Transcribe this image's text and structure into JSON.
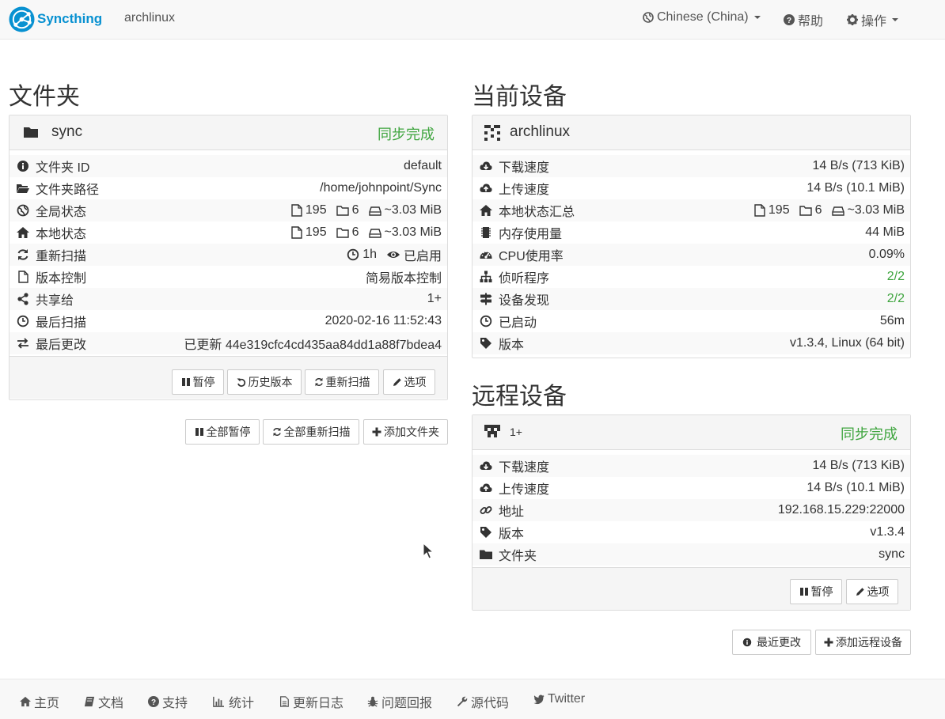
{
  "navbar": {
    "brand": "Syncthing",
    "hostname": "archlinux",
    "language": "Chinese (China)",
    "help": "帮助",
    "actions": "操作"
  },
  "folders": {
    "heading": "文件夹",
    "panel": {
      "name": "sync",
      "status": "同步完成",
      "rows": [
        {
          "label": "文件夹 ID",
          "value": "default"
        },
        {
          "label": "文件夹路径",
          "value": "/home/johnpoint/Sync"
        },
        {
          "label": "全局状态",
          "files": "195",
          "dirs": "6",
          "size": "~3.03 MiB"
        },
        {
          "label": "本地状态",
          "files": "195",
          "dirs": "6",
          "size": "~3.03 MiB"
        },
        {
          "label": "重新扫描",
          "interval": "1h",
          "watch": "已启用"
        },
        {
          "label": "版本控制",
          "value": "简易版本控制"
        },
        {
          "label": "共享给",
          "value": "1+"
        },
        {
          "label": "最后扫描",
          "value": "2020-02-16 11:52:43"
        },
        {
          "label": "最后更改",
          "value": "已更新 44e319cfc4cd435aa84dd1a88f7bdea4"
        }
      ],
      "buttons": {
        "pause": "暂停",
        "versions": "历史版本",
        "rescan": "重新扫描",
        "options": "选项"
      }
    },
    "actions": {
      "pause_all": "全部暂停",
      "rescan_all": "全部重新扫描",
      "add_folder": "添加文件夹"
    }
  },
  "this_device": {
    "heading": "当前设备",
    "name": "archlinux",
    "rows": [
      {
        "label": "下载速度",
        "value": "14 B/s (713 KiB)"
      },
      {
        "label": "上传速度",
        "value": "14 B/s (10.1 MiB)"
      },
      {
        "label": "本地状态汇总",
        "files": "195",
        "dirs": "6",
        "size": "~3.03 MiB"
      },
      {
        "label": "内存使用量",
        "value": "44 MiB"
      },
      {
        "label": "CPU使用率",
        "value": "0.09%"
      },
      {
        "label": "侦听程序",
        "value": "2/2"
      },
      {
        "label": "设备发现",
        "value": "2/2"
      },
      {
        "label": "已启动",
        "value": "56m"
      },
      {
        "label": "版本",
        "value": "v1.3.4, Linux (64 bit)"
      }
    ]
  },
  "remote_devices": {
    "heading": "远程设备",
    "panel": {
      "name": "1+",
      "status": "同步完成",
      "rows": [
        {
          "label": "下载速度",
          "value": "14 B/s (713 KiB)"
        },
        {
          "label": "上传速度",
          "value": "14 B/s (10.1 MiB)"
        },
        {
          "label": "地址",
          "value": "192.168.15.229:22000"
        },
        {
          "label": "版本",
          "value": "v1.3.4"
        },
        {
          "label": "文件夹",
          "value": "sync"
        }
      ],
      "buttons": {
        "pause": "暂停",
        "options": "选项"
      }
    },
    "actions": {
      "recent_changes": "最近更改",
      "add_device": "添加远程设备"
    }
  },
  "footer": {
    "home": "主页",
    "docs": "文档",
    "support": "支持",
    "stats": "统计",
    "changelog": "更新日志",
    "bugs": "问题回报",
    "source": "源代码",
    "twitter": "Twitter"
  },
  "colors": {
    "brand": "#0891d1",
    "success": "#3fa53f",
    "panel_bg": "#f5f5f5",
    "border": "#dddddd"
  }
}
